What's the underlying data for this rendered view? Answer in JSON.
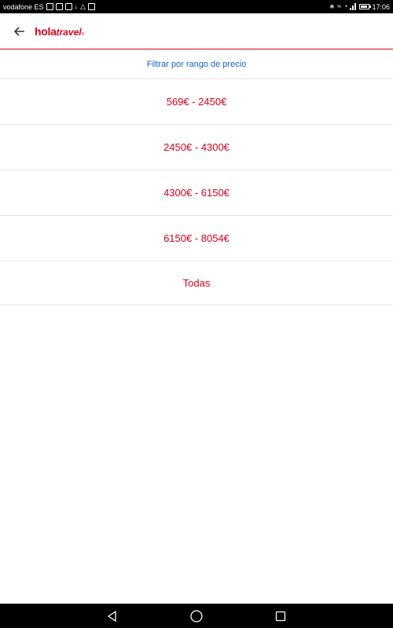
{
  "status_bar": {
    "carrier": "vodafone ES",
    "time": "17:06"
  },
  "app_bar": {
    "logo_hola": "hola",
    "logo_travel": "travel",
    "logo_reg": "®"
  },
  "filter": {
    "title": "Filtrar por rango de precio",
    "options": [
      {
        "label": "569€ - 2450€"
      },
      {
        "label": "2450€ - 4300€"
      },
      {
        "label": "4300€ - 6150€"
      },
      {
        "label": "6150€ - 8054€"
      },
      {
        "label": "Todas"
      }
    ]
  },
  "colors": {
    "brand": "#d6001c",
    "link": "#1565c0"
  },
  "icons": {
    "back": "arrow-back-icon",
    "nav_back": "triangle-back-icon",
    "nav_home": "circle-home-icon",
    "nav_recents": "square-recents-icon"
  }
}
